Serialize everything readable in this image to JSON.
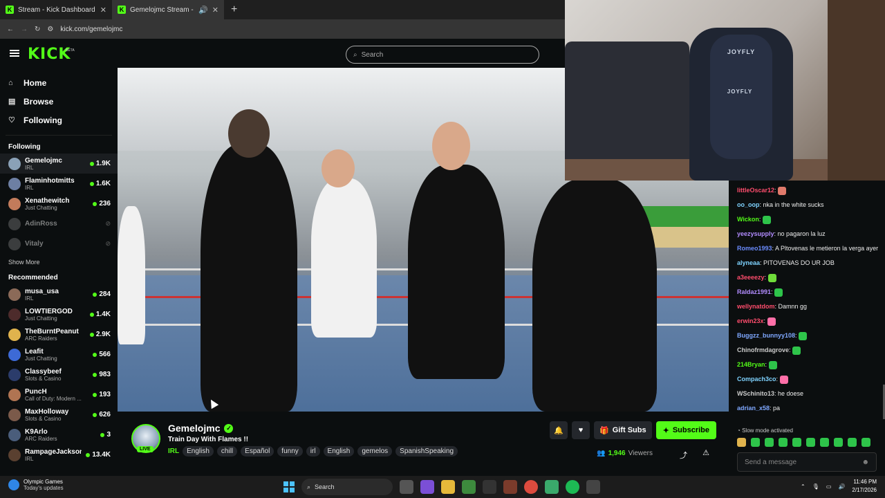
{
  "browser": {
    "tabs": [
      {
        "title": "Stream - Kick Dashboard"
      },
      {
        "title": "Gemelojmc Stream - Watch"
      }
    ],
    "url": "kick.com/gemelojmc"
  },
  "header": {
    "logo": "KICK",
    "beta": "BETA",
    "search_placeholder": "Search"
  },
  "sidebar": {
    "nav": [
      {
        "label": "Home"
      },
      {
        "label": "Browse"
      },
      {
        "label": "Following"
      }
    ],
    "following_title": "Following",
    "following": [
      {
        "name": "Gemelojmc",
        "category": "IRL",
        "viewers": "1.9K",
        "color": "#8aa1b7"
      },
      {
        "name": "Flaminhotmitts",
        "category": "IRL",
        "viewers": "1.6K",
        "color": "#6d7fa3"
      },
      {
        "name": "Xenathewitch",
        "category": "Just Chatting",
        "viewers": "236",
        "color": "#c27b5b"
      },
      {
        "name": "AdinRoss",
        "category": "",
        "viewers": "",
        "color": "#777"
      },
      {
        "name": "Vitaly",
        "category": "",
        "viewers": "",
        "color": "#777"
      }
    ],
    "show_more": "Show More",
    "recommended_title": "Recommended",
    "recommended": [
      {
        "name": "musa_usa",
        "category": "IRL",
        "viewers": "284",
        "color": "#8b6a58"
      },
      {
        "name": "LOWTIERGOD",
        "category": "Just Chatting",
        "viewers": "1.4K",
        "color": "#4d2b2b"
      },
      {
        "name": "TheBurntPeanut",
        "category": "ARC Raiders",
        "viewers": "2.9K",
        "color": "#e0b34d"
      },
      {
        "name": "Leafit",
        "category": "Just Chatting",
        "viewers": "566",
        "color": "#3d6ad6"
      },
      {
        "name": "Classybeef",
        "category": "Slots & Casino",
        "viewers": "983",
        "color": "#2b3c6b"
      },
      {
        "name": "PuncH",
        "category": "Call of Duty: Modern ...",
        "viewers": "193",
        "color": "#b07452"
      },
      {
        "name": "MaxHolloway",
        "category": "Slots & Casino",
        "viewers": "626",
        "color": "#7b5a4a"
      },
      {
        "name": "K9Arlo",
        "category": "ARC Raiders",
        "viewers": "3",
        "color": "#4a5d7b"
      },
      {
        "name": "RampageJackson",
        "category": "IRL",
        "viewers": "13.4K",
        "color": "#5a4030"
      }
    ]
  },
  "webcam": {
    "brand": "JOYFLY"
  },
  "stream": {
    "name": "Gemelojmc",
    "live": "LIVE",
    "title": "Train Day With Flames !!",
    "category": "IRL",
    "tags": [
      "English",
      "chill",
      "Español",
      "funny",
      "irl",
      "English",
      "gemelos",
      "SpanishSpeaking"
    ],
    "gift_label": "Gift Subs",
    "subscribe_label": "Subscribe",
    "viewers": "1,946",
    "viewers_label": "Viewers"
  },
  "chat": {
    "messages": [
      {
        "user": "littleOscar12",
        "text": "",
        "color": "#ff4d6d",
        "emote": "#e07a6b"
      },
      {
        "user": "oo_oop",
        "text": "nka in the white sucks",
        "color": "#7fd3ff",
        "emote": ""
      },
      {
        "user": "Wickon",
        "text": "",
        "color": "#53fc18",
        "emote": "#2ec44a"
      },
      {
        "user": "yeezysupply",
        "text": "no pagaron la luz",
        "color": "#b28cff",
        "emote": ""
      },
      {
        "user": "Romeo1993",
        "text": "A Pltovenas le metieron la verga ayer",
        "color": "#6b8cff",
        "emote": ""
      },
      {
        "user": "alyneaa",
        "text": "PITOVENAS DO UR JOB",
        "color": "#7fd3ff",
        "emote": ""
      },
      {
        "user": "a3eeeezy",
        "text": "",
        "color": "#ff4d6d",
        "emote": "#6fdc3a"
      },
      {
        "user": "Raldaz1991",
        "text": "",
        "color": "#b28cff",
        "emote": "#2ec44a"
      },
      {
        "user": "wellynatdom",
        "text": "Damnn gg",
        "color": "#ff4d6d",
        "emote": ""
      },
      {
        "user": "erwin23x",
        "text": "",
        "color": "#ff4d6d",
        "emote": "#ff6fa8"
      },
      {
        "user": "Buggzz_bunnyy108",
        "text": "",
        "color": "#7fa8ff",
        "emote": "#2ec44a"
      },
      {
        "user": "Chinofrmdagrove",
        "text": "",
        "color": "#cccccc",
        "emote": "#2ec44a"
      },
      {
        "user": "214Bryan",
        "text": "",
        "color": "#53fc18",
        "emote": "#2ec44a"
      },
      {
        "user": "Compach3co",
        "text": "",
        "color": "#7fd3ff",
        "emote": "#ff6fa8"
      },
      {
        "user": "WSchinito13",
        "text": "he doese",
        "color": "#cccccc",
        "emote": ""
      },
      {
        "user": "adrian_x58",
        "text": "pa",
        "color": "#7fa8ff",
        "emote": ""
      }
    ],
    "slow_mode": "Slow mode activated",
    "input_placeholder": "Send a message"
  },
  "taskbar": {
    "weather_title": "Olympic Games",
    "weather_sub": "Today's updates",
    "search": "Search",
    "time": "11:46 PM",
    "date": "2/17/2026"
  }
}
